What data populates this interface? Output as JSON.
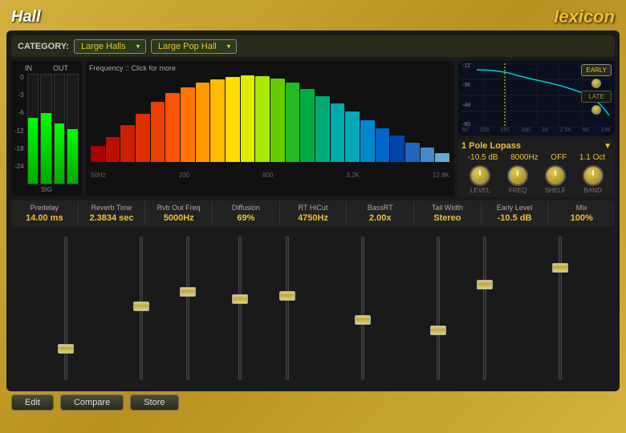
{
  "header": {
    "title": "Hall",
    "brand": "lexicon"
  },
  "category": {
    "label": "CATEGORY:",
    "value1": "Large Halls",
    "value2": "Large Pop Hall"
  },
  "vu": {
    "in_label": "IN",
    "out_label": "OUT",
    "sig_label": "SIG",
    "scale": [
      "0",
      "-3",
      "-6",
      "-12",
      "-18",
      "-24"
    ]
  },
  "spectrum": {
    "label": "Frequency :: Click for more",
    "axis": [
      "50Hz",
      "200",
      "800",
      "3.2K",
      "12.8K"
    ]
  },
  "eq_graph": {
    "db_labels": [
      "-12",
      "-36",
      "-48",
      "-60"
    ],
    "freq_labels": [
      "50",
      "100",
      "250",
      "500",
      "1K",
      "2.5K",
      "5K",
      "10K"
    ],
    "early_label": "EARLY",
    "late_label": "LATE"
  },
  "filter": {
    "title": "1 Pole Lopass",
    "params": [
      {
        "value": "-10.5 dB",
        "label": "LEVEL"
      },
      {
        "value": "8000Hz",
        "label": "FREQ"
      },
      {
        "value": "OFF",
        "label": "SHELF"
      },
      {
        "value": "1.1 Oct",
        "label": "BAND"
      }
    ]
  },
  "params": [
    {
      "label": "Predelay",
      "value": "14.00 ms"
    },
    {
      "label": "Reverb Time",
      "value": "2.3834 sec"
    },
    {
      "label": "Rvb Out Freq",
      "value": "5000Hz"
    },
    {
      "label": "Diffusion",
      "value": "69%"
    },
    {
      "label": "RT HiCut",
      "value": "4750Hz"
    },
    {
      "label": "BassRT",
      "value": "2.00x"
    },
    {
      "label": "Tail Width",
      "value": "Stereo"
    },
    {
      "label": "Early Level",
      "value": "-10.5 dB"
    },
    {
      "label": "Mix",
      "value": "100%"
    }
  ],
  "faders": {
    "count": 9,
    "positions": [
      0.85,
      0.55,
      0.45,
      0.5,
      0.48,
      0.65,
      0.72,
      0.38,
      0.25
    ]
  },
  "bottom_buttons": [
    {
      "label": "Edit"
    },
    {
      "label": "Compare"
    },
    {
      "label": "Store"
    }
  ]
}
